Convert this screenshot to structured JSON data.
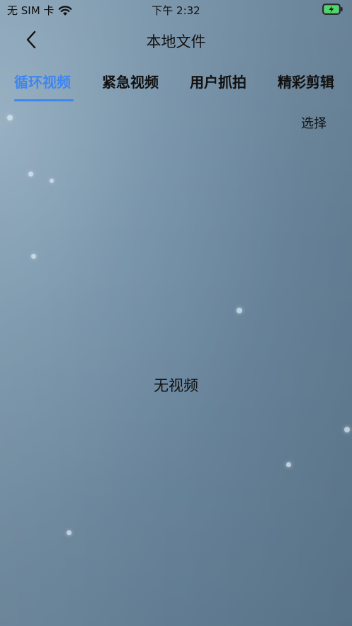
{
  "status_bar": {
    "carrier": "无 SIM 卡",
    "time": "下午 2:32",
    "icons": [
      "wifi-icon",
      "battery-charging-icon"
    ]
  },
  "nav": {
    "title": "本地文件",
    "back_icon": "chevron-left-icon"
  },
  "tabs": [
    {
      "label": "循环视频",
      "active": true
    },
    {
      "label": "紧急视频",
      "active": false
    },
    {
      "label": "用户抓拍",
      "active": false
    },
    {
      "label": "精彩剪辑",
      "active": false
    }
  ],
  "actions": {
    "select_label": "选择"
  },
  "content": {
    "empty_message": "无视频"
  },
  "colors": {
    "accent": "#3f86f0",
    "background": "#6f8ba1",
    "battery": "#4cd964"
  }
}
